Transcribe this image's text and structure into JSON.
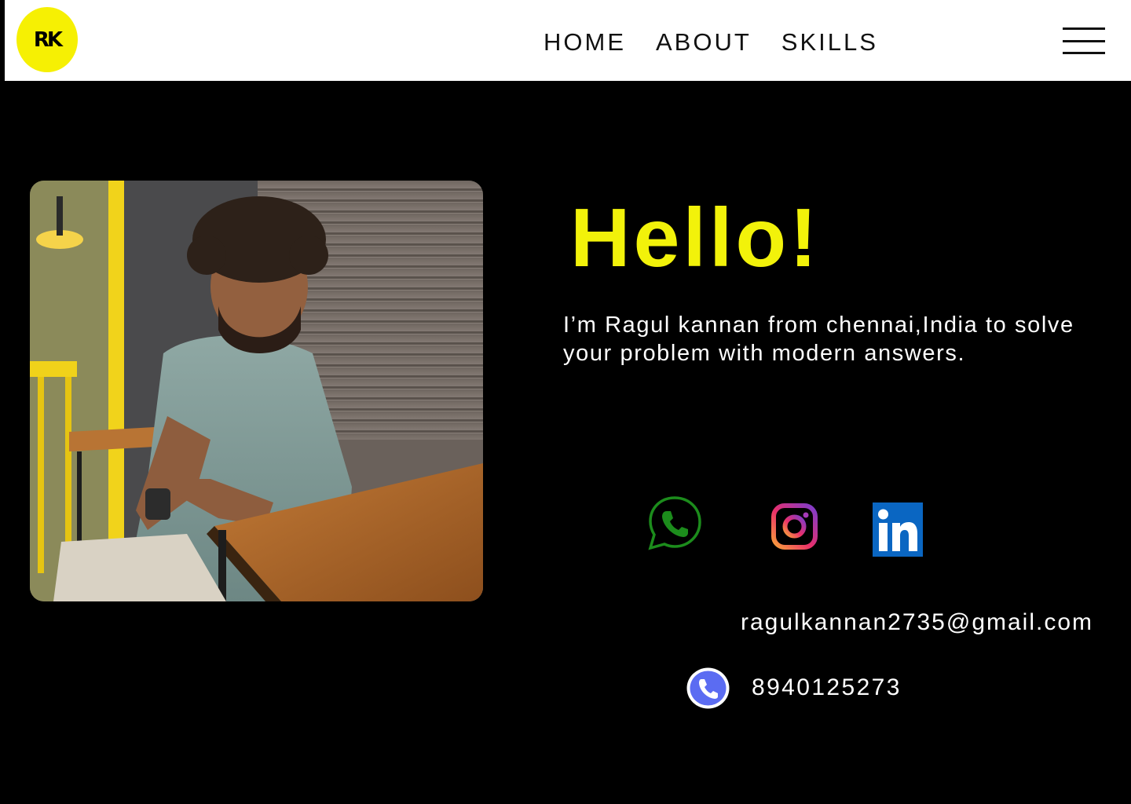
{
  "nav": {
    "logo_text": "RK",
    "links": [
      "HOME",
      "ABOUT",
      "SKILLS"
    ],
    "menu_icon": "hamburger-menu-icon"
  },
  "hero": {
    "greeting": "Hello!",
    "intro": "I’m Ragul kannan from chennai,India to solve your problem with modern answers."
  },
  "photo": {
    "subject": "portrait-photo"
  },
  "social": {
    "icons": [
      "whatsapp-icon",
      "instagram-icon",
      "linkedin-icon"
    ]
  },
  "contact": {
    "email": "ragulkannan2735@gmail.com",
    "phone": "8940125273"
  },
  "colors": {
    "accent": "#f2f20a",
    "background": "#000000",
    "navbar": "#ffffff",
    "whatsapp": "#1c8c1c",
    "linkedin": "#0a66c2",
    "phone_badge": "#5b6cf2"
  }
}
